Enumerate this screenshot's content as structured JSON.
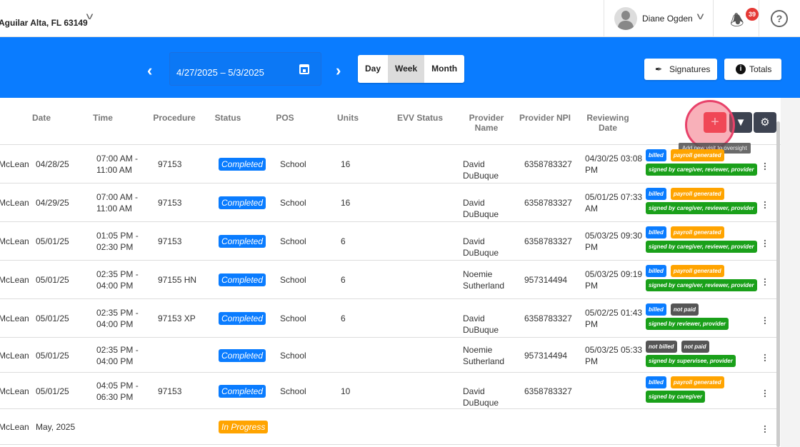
{
  "topbar": {
    "address": "Aguilar Alta, FL 63149",
    "user_name": "Diane Ogden",
    "notification_count": "39",
    "help": "?"
  },
  "toolbar": {
    "date_range": "4/27/2025 – 5/3/2025",
    "views": [
      "Day",
      "Week",
      "Month"
    ],
    "active_view": "Week",
    "signatures": "Signatures",
    "totals": "Totals"
  },
  "colors": {
    "brand": "#0a7cff",
    "completed": "#0a7cff",
    "in_progress": "#ffa400",
    "billed": "#0a7cff",
    "payroll": "#ffa400",
    "signed": "#1aa01a",
    "not": "#555555"
  },
  "table": {
    "headers": [
      "Date",
      "Time",
      "Procedure",
      "Status",
      "POS",
      "Units",
      "EVV Status",
      "Provider Name",
      "Provider NPI",
      "Reviewing Date"
    ],
    "add_tooltip": "Add new visit to oversight",
    "rows": [
      {
        "client": "McLean",
        "date": "04/28/25",
        "time": "07:00 AM - 11:00 AM",
        "procedure": "97153",
        "status": "Completed",
        "pos": "School",
        "units": "16",
        "evv": "",
        "provider": "David DuBuque",
        "npi": "6358783327",
        "reviewing": "04/30/25 03:08 PM",
        "badges": [
          [
            "billed",
            "payroll generated"
          ],
          [
            "signed by caregiver, reviewer, provider"
          ]
        ]
      },
      {
        "client": "McLean",
        "date": "04/29/25",
        "time": "07:00 AM - 11:00 AM",
        "procedure": "97153",
        "status": "Completed",
        "pos": "School",
        "units": "16",
        "evv": "",
        "provider": "David DuBuque",
        "npi": "6358783327",
        "reviewing": "05/01/25 07:33 AM",
        "badges": [
          [
            "billed",
            "payroll generated"
          ],
          [
            "signed by caregiver, reviewer, provider"
          ]
        ]
      },
      {
        "client": "McLean",
        "date": "05/01/25",
        "time": "01:05 PM - 02:30 PM",
        "procedure": "97153",
        "status": "Completed",
        "pos": "School",
        "units": "6",
        "evv": "",
        "provider": "David DuBuque",
        "npi": "6358783327",
        "reviewing": "05/03/25 09:30 PM",
        "badges": [
          [
            "billed",
            "payroll generated"
          ],
          [
            "signed by caregiver, reviewer, provider"
          ]
        ]
      },
      {
        "client": "McLean",
        "date": "05/01/25",
        "time": "02:35 PM - 04:00 PM",
        "procedure": "97155 HN",
        "status": "Completed",
        "pos": "School",
        "units": "6",
        "evv": "",
        "provider": "Noemie Sutherland",
        "npi": "957314494",
        "reviewing": "05/03/25 09:19 PM",
        "badges": [
          [
            "billed",
            "payroll generated"
          ],
          [
            "signed by caregiver, reviewer, provider"
          ]
        ]
      },
      {
        "client": "McLean",
        "date": "05/01/25",
        "time": "02:35 PM - 04:00 PM",
        "procedure": "97153 XP",
        "status": "Completed",
        "pos": "School",
        "units": "6",
        "evv": "",
        "provider": "David DuBuque",
        "npi": "6358783327",
        "reviewing": "05/02/25 01:43 PM",
        "badges": [
          [
            "billed",
            "not paid"
          ],
          [
            "signed by reviewer, provider"
          ]
        ]
      },
      {
        "client": "McLean",
        "date": "05/01/25",
        "time": "02:35 PM - 04:00 PM",
        "procedure": "",
        "status": "Completed",
        "pos": "School",
        "units": "",
        "evv": "",
        "provider": "Noemie Sutherland",
        "npi": "957314494",
        "reviewing": "05/03/25 05:33 PM",
        "badges": [
          [
            "not billed",
            "not paid"
          ],
          [
            "signed by supervisee, provider"
          ]
        ]
      },
      {
        "client": "McLean",
        "date": "05/01/25",
        "time": "04:05 PM - 06:30 PM",
        "procedure": "97153",
        "status": "Completed",
        "pos": "School",
        "units": "10",
        "evv": "",
        "provider": "David DuBuque",
        "npi": "6358783327",
        "reviewing": "",
        "badges": [
          [
            "billed",
            "payroll generated"
          ],
          [
            "signed by caregiver"
          ]
        ]
      },
      {
        "client": "McLean",
        "date": "May, 2025",
        "time": "",
        "procedure": "",
        "status": "In Progress",
        "pos": "",
        "units": "",
        "evv": "",
        "provider": "",
        "npi": "",
        "reviewing": "",
        "badges": []
      }
    ]
  }
}
